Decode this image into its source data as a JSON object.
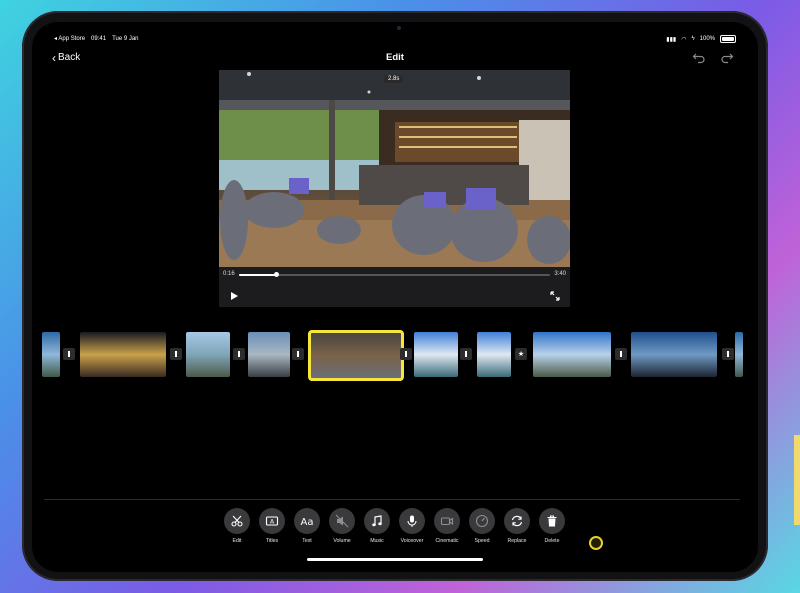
{
  "status": {
    "app": "App Store",
    "time": "09:41",
    "date": "Tue 9 Jan",
    "battery": "100%"
  },
  "nav": {
    "back_label": "Back",
    "title": "Edit"
  },
  "viewer": {
    "clip_duration": "2.8s",
    "current_time": "0:16",
    "total_time": "3:40",
    "progress": 0.12
  },
  "timeline": {
    "clips": [
      {
        "scene": "lagoon",
        "selected": false
      },
      {
        "scene": "night-market",
        "selected": false
      },
      {
        "scene": "lake-deck",
        "selected": false
      },
      {
        "scene": "boat-harbor",
        "selected": false
      },
      {
        "scene": "boat-lounge",
        "selected": true
      },
      {
        "scene": "bay-sky",
        "selected": false
      },
      {
        "scene": "bay-sky",
        "selected": false
      },
      {
        "scene": "harbor-wide",
        "selected": false
      },
      {
        "scene": "bay-dusk",
        "selected": false
      },
      {
        "scene": "lagoon",
        "selected": false
      }
    ],
    "transitions": [
      "cut",
      "cut",
      "cut",
      "cut",
      "cut",
      "cut",
      "star",
      "cut",
      "cut"
    ]
  },
  "toolbar": {
    "items": [
      {
        "label": "Edit",
        "icon": "scissors-icon"
      },
      {
        "label": "Titles",
        "icon": "titles-icon"
      },
      {
        "label": "Text",
        "icon": "text-icon"
      },
      {
        "label": "Volume",
        "icon": "volume-mute-icon"
      },
      {
        "label": "Music",
        "icon": "music-note-icon"
      },
      {
        "label": "Voiceover",
        "icon": "microphone-icon"
      },
      {
        "label": "Cinematic",
        "icon": "camera-icon"
      },
      {
        "label": "Speed",
        "icon": "speedometer-icon"
      },
      {
        "label": "Replace",
        "icon": "replace-icon"
      },
      {
        "label": "Delete",
        "icon": "trash-icon"
      }
    ]
  },
  "colors": {
    "accent": "#f6e63a",
    "button_bg": "#3a3a3c",
    "screen_bg": "#000000"
  }
}
